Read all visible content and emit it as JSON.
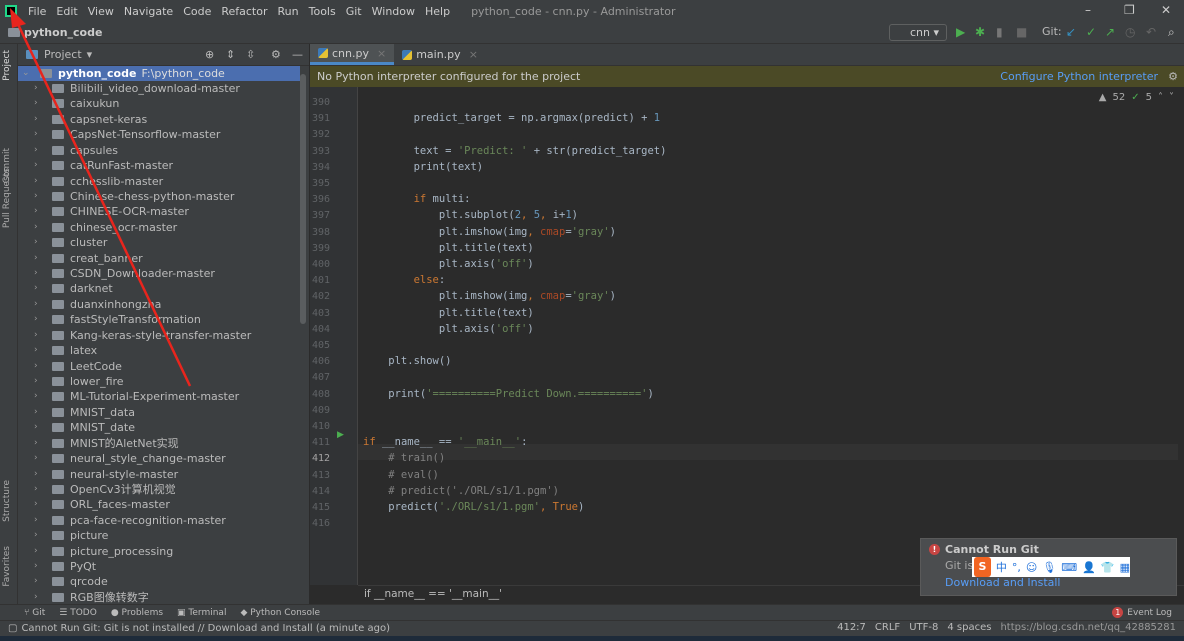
{
  "titlebar": {
    "menus": [
      "File",
      "Edit",
      "View",
      "Navigate",
      "Code",
      "Refactor",
      "Run",
      "Tools",
      "Git",
      "Window",
      "Help"
    ],
    "title": "python_code - cnn.py - Administrator",
    "minimize": "–",
    "maximize": "❐",
    "close": "✕"
  },
  "navbar": {
    "project": "python_code",
    "run_config": "cnn",
    "git_label": "Git:"
  },
  "side_tabs": [
    "Project",
    "Commit",
    "Pull Requests",
    "Structure",
    "Favorites"
  ],
  "project_panel": {
    "title": "Project",
    "root_name": "python_code",
    "root_path": "F:\\python_code",
    "items": [
      "Bilibili_video_download-master",
      "caixukun",
      "capsnet-keras",
      "CapsNet-Tensorflow-master",
      "capsules",
      "catRunFast-master",
      "cchesslib-master",
      "Chinese-chess-python-master",
      "CHINESE-OCR-master",
      "chinese_ocr-master",
      "cluster",
      "creat_banner",
      "CSDN_Downloader-master",
      "darknet",
      "duanxinhongzha",
      "fastStyleTransformation",
      "Kang-keras-style-transfer-master",
      "latex",
      "LeetCode",
      "lower_fire",
      "ML-Tutorial-Experiment-master",
      "MNIST_data",
      "MNIST_date",
      "MNIST的AletNet实现",
      "neural_style_change-master",
      "neural-style-master",
      "OpenCv3计算机视觉",
      "ORL_faces-master",
      "pca-face-recognition-master",
      "picture",
      "picture_processing",
      "PyQt",
      "qrcode",
      "RGB图像转数字"
    ]
  },
  "tabs": [
    {
      "label": "cnn.py",
      "active": true
    },
    {
      "label": "main.py",
      "active": false
    }
  ],
  "banner": {
    "message": "No Python interpreter configured for the project",
    "action": "Configure Python interpreter"
  },
  "inspections": {
    "warnings": "52",
    "weak": "5"
  },
  "editor": {
    "current_line": 412,
    "lines": [
      {
        "n": 390,
        "t": []
      },
      {
        "n": 391,
        "t": [
          [
            "        predict_target = np.argmax(predict) + ",
            ""
          ],
          [
            "1",
            "num"
          ]
        ]
      },
      {
        "n": 392,
        "t": []
      },
      {
        "n": 393,
        "t": [
          [
            "        text = ",
            ""
          ],
          [
            "'Predict: '",
            "str"
          ],
          [
            " + str(predict_target)",
            ""
          ]
        ]
      },
      {
        "n": 394,
        "t": [
          [
            "        print(text)",
            ""
          ]
        ]
      },
      {
        "n": 395,
        "t": []
      },
      {
        "n": 396,
        "t": [
          [
            "        ",
            ""
          ],
          [
            "if",
            "kw"
          ],
          [
            " multi:",
            ""
          ]
        ]
      },
      {
        "n": 397,
        "t": [
          [
            "            plt.subplot(",
            ""
          ],
          [
            "2",
            "num"
          ],
          [
            ", ",
            "kw"
          ],
          [
            "5",
            "num"
          ],
          [
            ", ",
            "kw"
          ],
          [
            "i+",
            ""
          ],
          [
            "1",
            "num"
          ],
          [
            ")",
            ""
          ]
        ]
      },
      {
        "n": 398,
        "t": [
          [
            "            plt.imshow(img",
            ""
          ],
          [
            ", ",
            "kw"
          ],
          [
            "cmap",
            "param"
          ],
          [
            "=",
            ""
          ],
          [
            "'gray'",
            "str"
          ],
          [
            ")",
            ""
          ]
        ]
      },
      {
        "n": 399,
        "t": [
          [
            "            plt.title(text)",
            ""
          ]
        ]
      },
      {
        "n": 400,
        "t": [
          [
            "            plt.axis(",
            ""
          ],
          [
            "'off'",
            "str"
          ],
          [
            ")",
            ""
          ]
        ]
      },
      {
        "n": 401,
        "t": [
          [
            "        ",
            ""
          ],
          [
            "else",
            "kw"
          ],
          [
            ":",
            ""
          ]
        ]
      },
      {
        "n": 402,
        "t": [
          [
            "            plt.imshow(img",
            ""
          ],
          [
            ", ",
            "kw"
          ],
          [
            "cmap",
            "param"
          ],
          [
            "=",
            ""
          ],
          [
            "'gray'",
            "str"
          ],
          [
            ")",
            ""
          ]
        ]
      },
      {
        "n": 403,
        "t": [
          [
            "            plt.title(text)",
            ""
          ]
        ]
      },
      {
        "n": 404,
        "t": [
          [
            "            plt.axis(",
            ""
          ],
          [
            "'off'",
            "str"
          ],
          [
            ")",
            ""
          ]
        ]
      },
      {
        "n": 405,
        "t": []
      },
      {
        "n": 406,
        "t": [
          [
            "    plt.show()",
            ""
          ]
        ]
      },
      {
        "n": 407,
        "t": []
      },
      {
        "n": 408,
        "t": [
          [
            "    print(",
            ""
          ],
          [
            "'==========Predict Down.=========='",
            "str"
          ],
          [
            ")",
            ""
          ]
        ]
      },
      {
        "n": 409,
        "t": []
      },
      {
        "n": 410,
        "t": []
      },
      {
        "n": 411,
        "t": [
          [
            "if",
            "kw"
          ],
          [
            " __name__ == ",
            ""
          ],
          [
            "'__main__'",
            "str"
          ],
          [
            ":",
            ""
          ]
        ]
      },
      {
        "n": 412,
        "t": [
          [
            "    # train()",
            "cm"
          ]
        ]
      },
      {
        "n": 413,
        "t": [
          [
            "    # eval()",
            "cm"
          ]
        ]
      },
      {
        "n": 414,
        "t": [
          [
            "    # predict('./ORL/s1/1.pgm')",
            "cm"
          ]
        ]
      },
      {
        "n": 415,
        "t": [
          [
            "    predict(",
            ""
          ],
          [
            "'./ORL/s1/1.pgm'",
            "str"
          ],
          [
            ", ",
            "kw"
          ],
          [
            "True",
            "kw"
          ],
          [
            ")",
            ""
          ]
        ]
      },
      {
        "n": 416,
        "t": []
      }
    ],
    "breadcrumb": "if __name__ == '__main__'"
  },
  "bottom_tools": [
    "Git",
    "TODO",
    "Problems",
    "Terminal",
    "Python Console"
  ],
  "event_log": "Event Log",
  "event_count": "1",
  "status": {
    "message": "Cannot Run Git: Git is not installed // Download and Install (a minute ago)",
    "position": "412:7",
    "line_sep": "CRLF",
    "encoding": "UTF-8",
    "indent": "4 spaces",
    "watermark": "https://blog.csdn.net/qq_42885281"
  },
  "notification": {
    "title": "Cannot Run Git",
    "body": "Git is n",
    "link": "Download and Install"
  },
  "ime": {
    "logo": "S",
    "mode": "中",
    "punct": "°,"
  },
  "colors": {
    "accent": "#4a88c7",
    "selection": "#4b6eaf",
    "annotation_arrow": "#e8251d"
  }
}
